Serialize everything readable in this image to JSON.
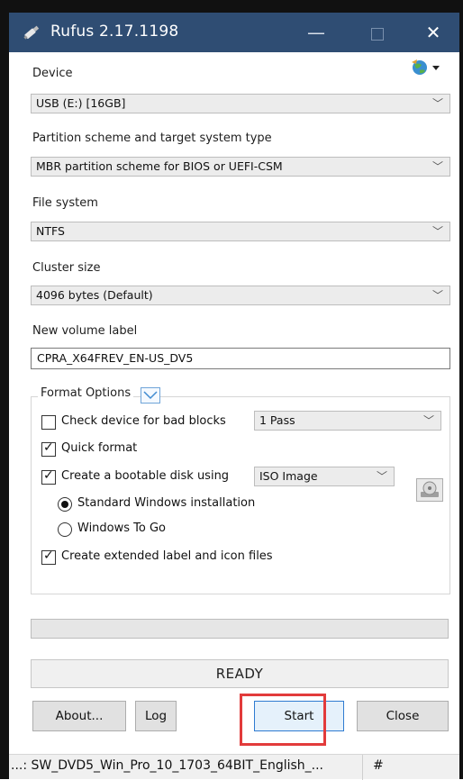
{
  "window": {
    "title": "Rufus 2.17.1198",
    "min_glyph": "—",
    "close_glyph": "✕"
  },
  "device": {
    "label": "Device",
    "value": "USB (E:) [16GB]"
  },
  "partition": {
    "label": "Partition scheme and target system type",
    "value": "MBR partition scheme for BIOS or UEFI-CSM"
  },
  "filesystem": {
    "label": "File system",
    "value": "NTFS"
  },
  "cluster": {
    "label": "Cluster size",
    "value": "4096 bytes (Default)"
  },
  "volume": {
    "label": "New volume label",
    "value": "CPRA_X64FREV_EN-US_DV5"
  },
  "format_options": {
    "title": "Format Options",
    "bad_blocks": {
      "label": "Check device for bad blocks",
      "checked": false,
      "passes": "1 Pass"
    },
    "quick_format": {
      "label": "Quick format",
      "checked": true
    },
    "bootable": {
      "label": "Create a bootable disk using",
      "checked": true,
      "source": "ISO Image"
    },
    "standard_install": {
      "label": "Standard Windows installation",
      "selected": true
    },
    "windows_to_go": {
      "label": "Windows To Go",
      "selected": false
    },
    "extended_label": {
      "label": "Create extended label and icon files",
      "checked": true
    }
  },
  "progress": {
    "fraction": 0
  },
  "status": {
    "text": "READY"
  },
  "buttons": {
    "about": "About...",
    "log": "Log",
    "start": "Start",
    "close": "Close"
  },
  "footer": {
    "file": "...: SW_DVD5_Win_Pro_10_1703_64BIT_English_...",
    "hash": "#"
  },
  "colors": {
    "titlebar": "#2f4d73",
    "highlight": "#e23b3b",
    "start_border": "#2f7bd1"
  },
  "icons": {
    "title": "rufus-usb-icon",
    "language": "globe-language-icon",
    "iso": "disc-drive-icon"
  }
}
